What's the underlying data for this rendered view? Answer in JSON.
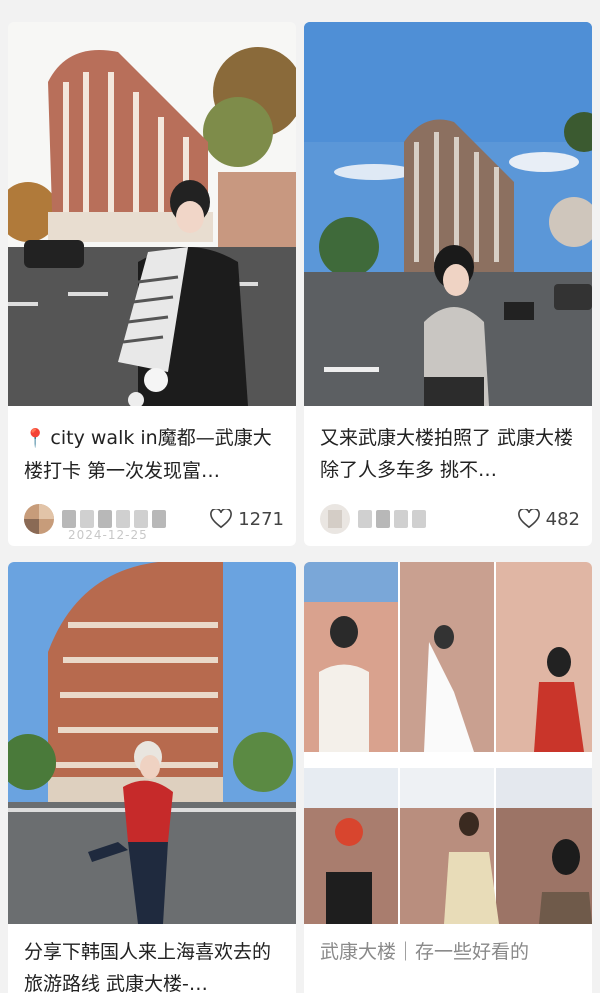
{
  "feed": {
    "cards": [
      {
        "title": "city walk in魔都—武康大楼打卡 第一次发现富…",
        "likes": "1271",
        "date": "2024-12-25"
      },
      {
        "title": "又来武康大楼拍照了 武康大楼除了人多车多 挑不…",
        "likes": "482"
      },
      {
        "title": "分享下韩国人来上海喜欢去的旅游路线 武康大楼-…"
      },
      {
        "title": "武康大楼｜存一些好看的"
      }
    ]
  },
  "icons": [
    "location-pin-icon",
    "heart-icon"
  ]
}
